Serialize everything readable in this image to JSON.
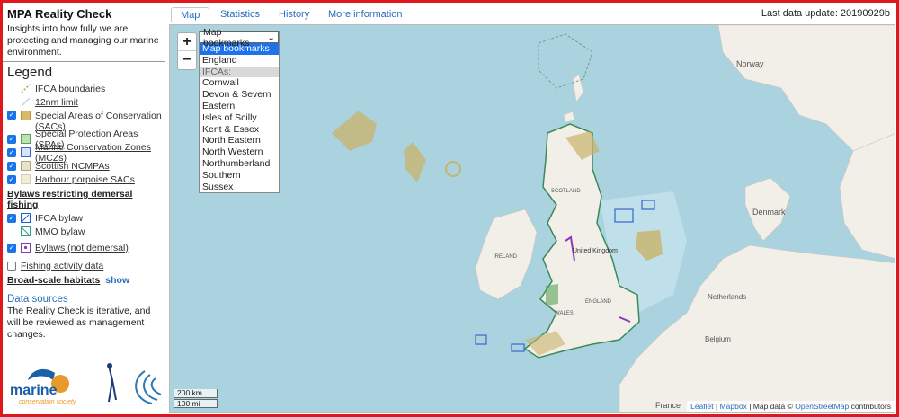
{
  "app": {
    "title": "MPA Reality Check",
    "intro": "Insights into how fully we are protecting and managing our marine environment."
  },
  "legend": {
    "heading": "Legend",
    "items": [
      {
        "label": "IFCA boundaries",
        "checkbox": "none",
        "swatch": "#7bbf3a"
      },
      {
        "label": "12nm limit",
        "checkbox": "none",
        "swatch": "#c7d6d6"
      },
      {
        "label": "Special Areas of Conservation (SACs)",
        "checkbox": "checked",
        "swatch": "#d9b86a"
      },
      {
        "label": "Special Protection Areas (SPAs)",
        "checkbox": "checked",
        "swatch": "#5aa05a"
      },
      {
        "label": "Marine Conservation Zones (MCZs)",
        "checkbox": "checked",
        "swatch": "#3a66c8"
      },
      {
        "label": "Scottish NCMPAs",
        "checkbox": "checked",
        "swatch": "#e8e2c8"
      },
      {
        "label": "Harbour porpoise SACs",
        "checkbox": "checked",
        "swatch": "#f3edd8"
      }
    ],
    "bylaws_heading": "Bylaws restricting demersal fishing",
    "bylaw_items": [
      {
        "label": "IFCA bylaw",
        "checkbox": "checked",
        "swatch": "#1a5bd8"
      },
      {
        "label": "MMO bylaw",
        "checkbox": "none",
        "swatch": "#2aa090"
      }
    ],
    "bylaws_not_demersal": {
      "label": "Bylaws (not demersal)",
      "checkbox": "checked",
      "swatch": "#8a3ab0"
    },
    "fishing_activity": {
      "label": "Fishing activity data",
      "checkbox": "unchecked"
    },
    "broad_scale": {
      "label": "Broad-scale habitats",
      "action": "show"
    }
  },
  "data_sources": {
    "heading": "Data sources",
    "text": "The Reality Check is iterative, and will be reviewed as management changes."
  },
  "logos": {
    "org_name": "marine",
    "org_sub": "conservation society"
  },
  "tabs": [
    {
      "label": "Map",
      "active": true
    },
    {
      "label": "Statistics",
      "active": false
    },
    {
      "label": "History",
      "active": false
    },
    {
      "label": "More information",
      "active": false
    }
  ],
  "last_update": "Last data update: 20190929b",
  "map": {
    "zoom_in": "+",
    "zoom_out": "−",
    "bookmarks": {
      "selected": "Map bookmarks",
      "options": [
        "Map bookmarks",
        "England",
        "IFCAs:",
        "Cornwall",
        "Devon & Severn",
        "Eastern",
        "Isles of Scilly",
        "Kent & Essex",
        "North Eastern",
        "North Western",
        "Northumberland",
        "Southern",
        "Sussex"
      ],
      "highlighted_index": 0,
      "group_index": 2
    },
    "scale": [
      "200 km",
      "100 mi"
    ],
    "attribution": {
      "leaflet": "Leaflet",
      "sep1": " | ",
      "mapbox": "Mapbox",
      "sep2": " | Map data © ",
      "osm": "OpenStreetMap",
      "tail": " contributors"
    },
    "place_labels": [
      "Norway",
      "Denmark",
      "United Kingdom",
      "SCOTLAND",
      "ENGLAND",
      "WALES",
      "IRELAND",
      "France",
      "Belgium",
      "Netherlands"
    ]
  },
  "colors": {
    "frame": "#e0181c",
    "sea": "#aad3df",
    "land": "#f2efe9",
    "accent": "#2a6ebb"
  }
}
